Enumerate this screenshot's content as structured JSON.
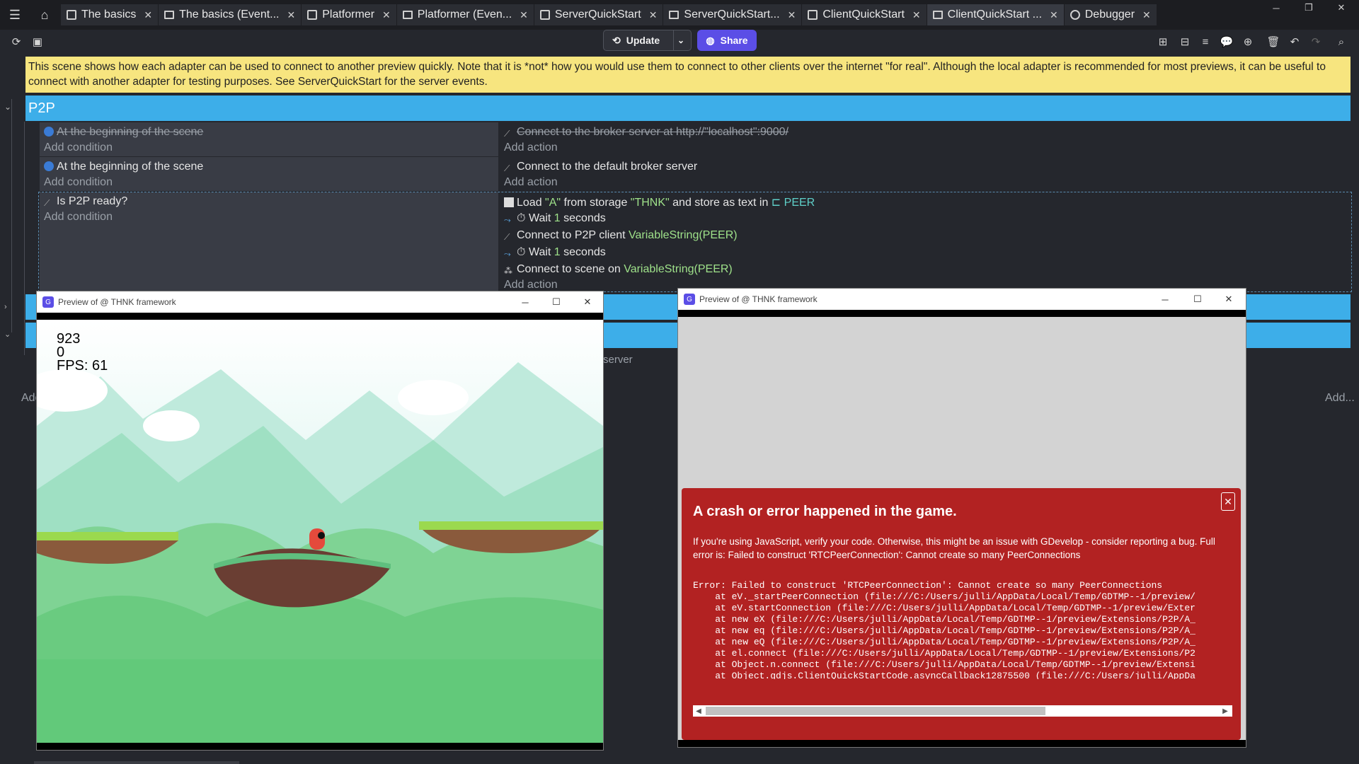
{
  "tabs": [
    {
      "label": "The basics",
      "icon": "scene-icon"
    },
    {
      "label": "The basics (Event...",
      "icon": "events-icon"
    },
    {
      "label": "Platformer",
      "icon": "scene-icon"
    },
    {
      "label": "Platformer (Even...",
      "icon": "events-icon"
    },
    {
      "label": "ServerQuickStart",
      "icon": "scene-icon"
    },
    {
      "label": "ServerQuickStart...",
      "icon": "events-icon"
    },
    {
      "label": "ClientQuickStart",
      "icon": "scene-icon"
    },
    {
      "label": "ClientQuickStart ...",
      "icon": "events-icon"
    },
    {
      "label": "Debugger",
      "icon": "debugger-icon"
    }
  ],
  "toolbar": {
    "update_label": "Update",
    "share_label": "Share"
  },
  "comment": "This scene shows how each adapter can be used to connect to another preview quickly. Note that it is *not* how you would use them to connect to other clients over the internet \"for real\". Although the local adapter is recommended for most previews, it can be useful to connect with another adapter for testing purposes. See ServerQuickStart for the server events.",
  "group": {
    "name": "P2P"
  },
  "events": {
    "e1": {
      "condition": "At the beginning of the scene",
      "action": "Connect to the broker server at http://\"localhost\":9000/"
    },
    "e2": {
      "condition": "At the beginning of the scene",
      "action": "Connect to the default broker server"
    },
    "e3": {
      "condition": "Is P2P ready?",
      "a1_pre": "Load ",
      "a1_key": "\"A\"",
      "a1_mid": " from storage ",
      "a1_store": "\"THNK\"",
      "a1_post": " and store as text in ",
      "a1_var": "PEER",
      "a2_pre": "Wait ",
      "a2_num": "1",
      "a2_post": " seconds",
      "a3_pre": "Connect to P2P client ",
      "a3_expr": "VariableString(PEER)",
      "a4_pre": "Wait ",
      "a4_num": "1",
      "a4_post": " seconds",
      "a5_pre": "Connect to scene on ",
      "a5_expr": "VariableString(PEER)"
    },
    "add_condition": "Add condition",
    "add_action": "Add action",
    "fragment_server": "server",
    "fragment_add_left": "Add",
    "fragment_add_right": "Add..."
  },
  "preview1": {
    "title": "Preview of @ THNK framework",
    "hud": [
      "923",
      "0",
      "FPS: 61"
    ]
  },
  "preview2": {
    "title": "Preview of @ THNK framework",
    "error_title": "A crash or error happened in the game.",
    "error_desc": "If you're using JavaScript, verify your code. Otherwise, this might be an issue with GDevelop - consider reporting a bug. Full error is: Failed to construct 'RTCPeerConnection': Cannot create so many PeerConnections",
    "error_trace": "Error: Failed to construct 'RTCPeerConnection': Cannot create so many PeerConnections\n    at eV._startPeerConnection (file:///C:/Users/julli/AppData/Local/Temp/GDTMP--1/preview/\n    at eV.startConnection (file:///C:/Users/julli/AppData/Local/Temp/GDTMP--1/preview/Exter\n    at new eX (file:///C:/Users/julli/AppData/Local/Temp/GDTMP--1/preview/Extensions/P2P/A_\n    at new eq (file:///C:/Users/julli/AppData/Local/Temp/GDTMP--1/preview/Extensions/P2P/A_\n    at new eQ (file:///C:/Users/julli/AppData/Local/Temp/GDTMP--1/preview/Extensions/P2P/A_\n    at el.connect (file:///C:/Users/julli/AppData/Local/Temp/GDTMP--1/preview/Extensions/P2\n    at Object.n.connect (file:///C:/Users/julli/AppData/Local/Temp/GDTMP--1/preview/Extensi\n    at Object.gdjs.ClientQuickStartCode.asyncCallback12875500 (file:///C:/Users/julli/AppDa\n    at Object.callback (file:///C:/Users/julli/AppData/Local/Temp/GDTMP--1/preview/code3.js\n    at l.processTasks (file:///C:/Users/julli/AppData/Local/Temp/GDTMP--1/preview/AsyncTasl"
  }
}
